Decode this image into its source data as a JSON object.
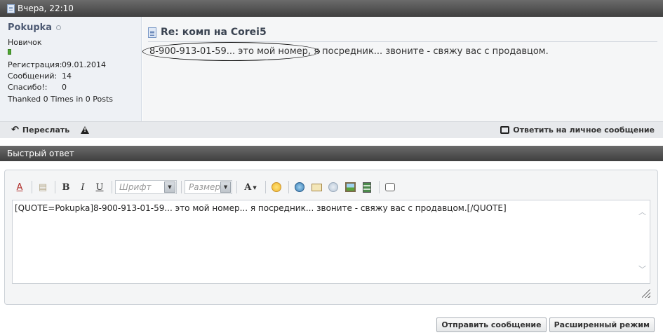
{
  "post": {
    "date": "Вчера, 22:10",
    "title": "Re: комп на Corei5",
    "message_circled": "8-900-913-01-59... это мой номер,",
    "message_rest": " я посредник... звоните - свяжу вас с продавцом."
  },
  "user": {
    "name": "Pokupka",
    "title": "Новичок",
    "stats": [
      {
        "label": "Регистрация:",
        "value": "09.01.2014"
      },
      {
        "label": "Сообщений:",
        "value": "14"
      },
      {
        "label": "Спасибо!:",
        "value": "0"
      }
    ],
    "thanked": "Thanked 0 Times in 0 Posts"
  },
  "actions": {
    "forward": "Переслать",
    "reply_pm": "Ответить на личное сообщение"
  },
  "quick_reply": {
    "title": "Быстрый ответ",
    "font_placeholder": "Шрифт",
    "size_placeholder": "Размер",
    "editor_text": "[QUOTE=Pokupka]8-900-913-01-59... это мой номер... я посредник... звоните - свяжу вас с продавцом.[/QUOTE]",
    "submit": "Отправить сообщение",
    "advanced": "Расширенный режим"
  },
  "colors": {
    "header": "#4a4a4a",
    "rep": "#4fa832",
    "username": "#4d5a73"
  }
}
